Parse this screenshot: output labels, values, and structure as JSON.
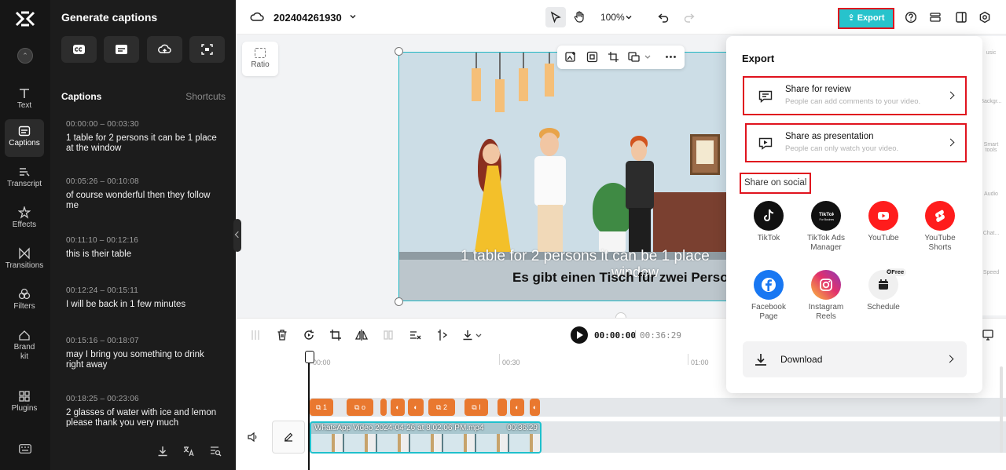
{
  "nav": {
    "items": [
      {
        "label": "Text",
        "icon": "text-icon"
      },
      {
        "label": "Captions",
        "icon": "captions-icon",
        "active": true
      },
      {
        "label": "Transcript",
        "icon": "transcript-icon"
      },
      {
        "label": "Effects",
        "icon": "effects-icon"
      },
      {
        "label": "Transitions",
        "icon": "transitions-icon"
      },
      {
        "label": "Filters",
        "icon": "filters-icon"
      },
      {
        "label": "Brand kit",
        "icon": "brand-kit-icon"
      },
      {
        "label": "Plugins",
        "icon": "plugins-icon"
      }
    ]
  },
  "captions_panel": {
    "title": "Generate captions",
    "section_title": "Captions",
    "shortcuts_label": "Shortcuts",
    "items": [
      {
        "time": "00:00:00 – 00:03:30",
        "text": "1 table for 2 persons it can be 1 place at the window"
      },
      {
        "time": "00:05:26 – 00:10:08",
        "text": "of course wonderful then they follow me"
      },
      {
        "time": "00:11:10 – 00:12:16",
        "text": "this is their table"
      },
      {
        "time": "00:12:24 – 00:15:11",
        "text": "I will be back in 1 few minutes"
      },
      {
        "time": "00:15:16 – 00:18:07",
        "text": "may I bring you something to drink right away"
      },
      {
        "time": "00:18:25 – 00:23:06",
        "text": "2 glasses of water with ice and lemon please thank you very much"
      }
    ]
  },
  "topbar": {
    "project_name": "202404261930",
    "zoom": "100%",
    "export_label": "Export"
  },
  "canvas": {
    "ratio_label": "Ratio",
    "subtitle_line1": "1 table for 2 persons it can be 1 place",
    "subtitle_line1b": "window",
    "subtitle_line2": "Es gibt einen Tisch für zwei Personen"
  },
  "timeline": {
    "current_time": "00:00:00",
    "separator": "|",
    "total_time": "00:36:29",
    "ruler": [
      "00:00",
      "00:30",
      "01:00"
    ],
    "clip_name": "WhatsApp Video 2024-04-26 at 8.02.06 PM.mp4",
    "clip_duration": "00:36:29",
    "caption_chips": [
      "1",
      "o",
      "",
      "",
      "2",
      "I",
      "",
      "",
      ""
    ]
  },
  "side_panel": {
    "items": [
      "usic",
      "Backgr...",
      "Smart tools",
      "Audio",
      "Chat...",
      "Speed"
    ]
  },
  "export": {
    "title": "Export",
    "share_review_title": "Share for review",
    "share_review_sub": "People can add comments to your video.",
    "share_presentation_title": "Share as presentation",
    "share_presentation_sub": "People can only watch your video.",
    "social_label": "Share on social",
    "socials": [
      {
        "name": "TikTok",
        "color": "#111111"
      },
      {
        "name": "TikTok Ads Manager",
        "color": "#111111"
      },
      {
        "name": "YouTube",
        "color": "#ff1c1c"
      },
      {
        "name": "YouTube Shorts",
        "color": "#ff1c1c"
      },
      {
        "name": "Facebook Page",
        "color": "#1877f2"
      },
      {
        "name": "Instagram Reels",
        "color": "#e1306c"
      },
      {
        "name": "Schedule",
        "color": "#f0f0f0"
      }
    ],
    "free_badge": "Free",
    "download_label": "Download",
    "highlight_color": "#e0131e",
    "accent_color": "#27c3cc"
  }
}
